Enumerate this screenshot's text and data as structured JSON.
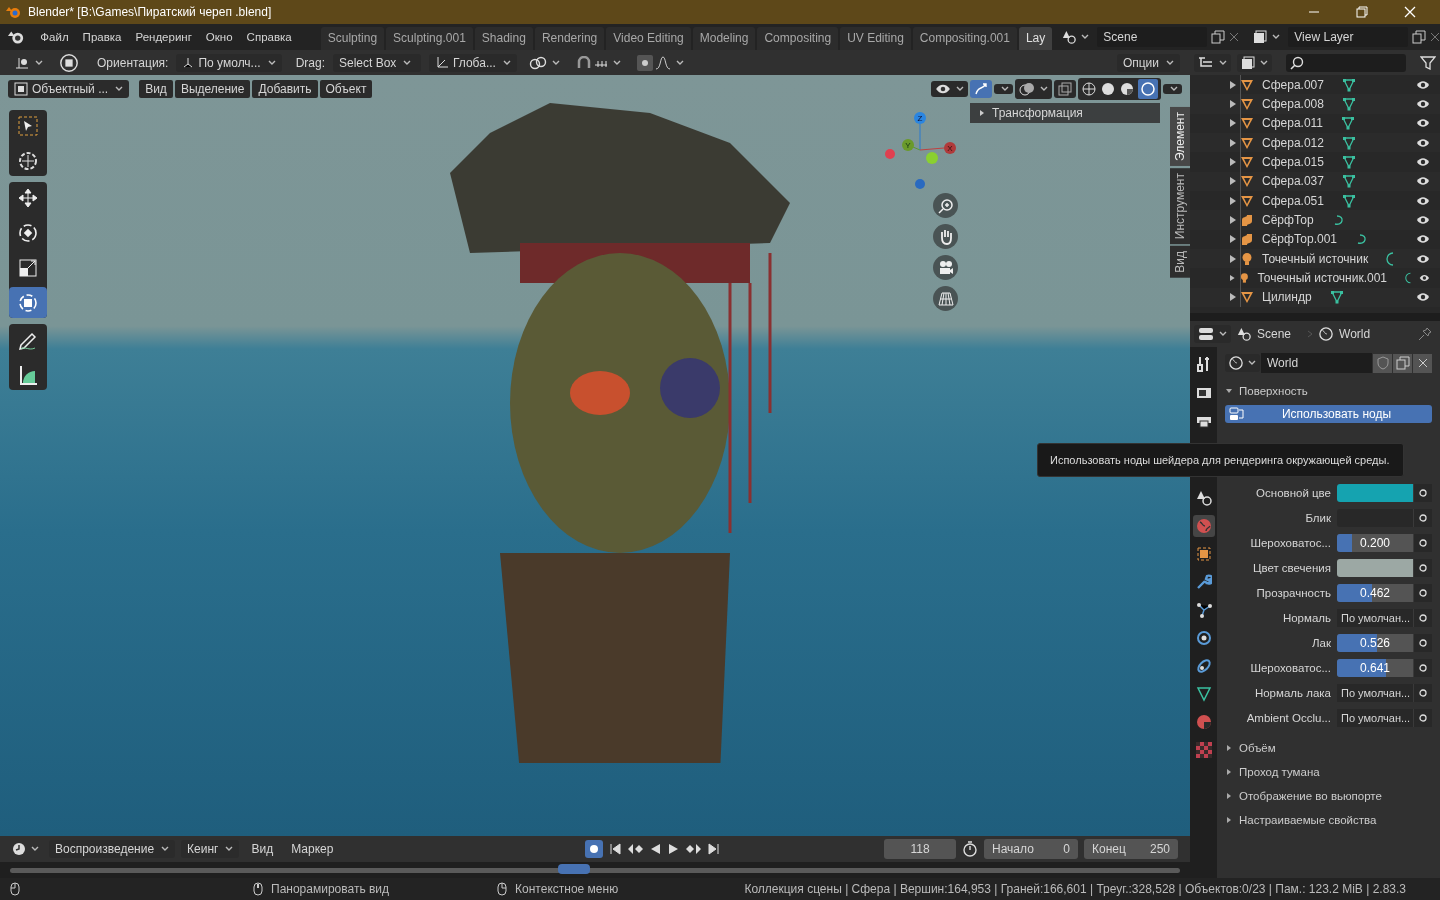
{
  "window": {
    "title": "Blender* [B:\\Games\\Пиратский череп .blend]"
  },
  "menu": [
    "Файл",
    "Правка",
    "Рендеринг",
    "Окно",
    "Справка"
  ],
  "workspace_tabs": [
    {
      "label": "Sculpting",
      "selected": false
    },
    {
      "label": "Sculpting.001",
      "selected": false
    },
    {
      "label": "Shading",
      "selected": false
    },
    {
      "label": "Rendering",
      "selected": false
    },
    {
      "label": "Video Editing",
      "selected": false
    },
    {
      "label": "Modeling",
      "selected": false
    },
    {
      "label": "Compositing",
      "selected": false
    },
    {
      "label": "UV Editing",
      "selected": false
    },
    {
      "label": "Compositing.001",
      "selected": false
    },
    {
      "label": "Lay",
      "selected": true
    }
  ],
  "scene": "Scene",
  "view_layer": "View Layer",
  "tool_header": {
    "orientation_label": "Ориентация:",
    "orientation": "По умолч...",
    "drag_label": "Drag:",
    "drag": "Select Box",
    "transform": "Глоба...",
    "options": "Опции"
  },
  "viewport_header": {
    "mode": "Объектный ...",
    "menus": [
      "Вид",
      "Выделение",
      "Добавить",
      "Объект"
    ]
  },
  "tool_groups": [
    [
      {
        "kind": "select",
        "selected": false
      },
      {
        "kind": "cursor",
        "selected": false
      }
    ],
    [
      {
        "kind": "move",
        "selected": false
      },
      {
        "kind": "rotate",
        "selected": false
      },
      {
        "kind": "scale",
        "selected": false
      },
      {
        "kind": "transform",
        "selected": true
      }
    ],
    [
      {
        "kind": "annotate",
        "selected": false
      },
      {
        "kind": "measure",
        "selected": false
      }
    ]
  ],
  "gizmo": {
    "x": "X",
    "y": "Y",
    "z": "Z"
  },
  "sidebar": {
    "panel": "Трансформация",
    "tabs": [
      {
        "label": "Элемент",
        "selected": true
      },
      {
        "label": "Инструмент",
        "selected": false
      },
      {
        "label": "Вид",
        "selected": false
      }
    ]
  },
  "outliner": {
    "items": [
      {
        "name": "Сфера.007",
        "kind": "mesh"
      },
      {
        "name": "Сфера.008",
        "kind": "mesh"
      },
      {
        "name": "Сфера.011",
        "kind": "mesh"
      },
      {
        "name": "Сфера.012",
        "kind": "mesh"
      },
      {
        "name": "Сфера.015",
        "kind": "mesh"
      },
      {
        "name": "Сфера.037",
        "kind": "mesh"
      },
      {
        "name": "Сфера.051",
        "kind": "mesh"
      },
      {
        "name": "СёрфТор",
        "kind": "surface"
      },
      {
        "name": "СёрфТор.001",
        "kind": "surface"
      },
      {
        "name": "Точечный источник",
        "kind": "light"
      },
      {
        "name": "Точечный источник.001",
        "kind": "light"
      },
      {
        "name": "Цилиндр",
        "kind": "mesh"
      }
    ]
  },
  "properties": {
    "breadcrumb": [
      "Scene",
      "World"
    ],
    "datablock": "World",
    "tabs": [
      {
        "kind": "tool",
        "selected": false
      },
      {
        "kind": "render",
        "selected": false
      },
      {
        "kind": "output",
        "selected": false
      },
      {
        "kind": "scene",
        "selected": false
      },
      {
        "kind": "world",
        "selected": true
      },
      {
        "kind": "object",
        "selected": false
      },
      {
        "kind": "modifiers",
        "selected": false
      },
      {
        "kind": "particles",
        "selected": false
      },
      {
        "kind": "physics",
        "selected": false
      },
      {
        "kind": "constraints",
        "selected": false
      },
      {
        "kind": "data",
        "selected": false
      },
      {
        "kind": "material",
        "selected": false
      },
      {
        "kind": "texture",
        "selected": false
      }
    ],
    "surface_panel": "Поверхность",
    "use_nodes": "Использовать ноды",
    "rows": [
      {
        "label": "Основной цве",
        "kind": "color",
        "color": "#15a3b0"
      },
      {
        "label": "Блик",
        "kind": "color",
        "color": "#282828"
      },
      {
        "label": "Шероховатос...",
        "kind": "slider",
        "value": "0.200",
        "level": 0.2
      },
      {
        "label": "Цвет свечения",
        "kind": "color",
        "color": "#9ca8a4"
      },
      {
        "label": "Прозрачность",
        "kind": "slider",
        "value": "0.462",
        "level": 0.462
      },
      {
        "label": "Нормаль",
        "kind": "dropdown",
        "value": "По умолчан..."
      },
      {
        "label": "Лак",
        "kind": "slider",
        "value": "0.526",
        "level": 0.526
      },
      {
        "label": "Шероховатос...",
        "kind": "slider",
        "value": "0.641",
        "level": 0.641
      },
      {
        "label": "Нормаль лака",
        "kind": "dropdown",
        "value": "По умолчан..."
      },
      {
        "label": "Ambient Occlu...",
        "kind": "dropdown",
        "value": "По умолчан..."
      }
    ],
    "collapsed_panels": [
      "Объём",
      "Проход тумана",
      "Отображение во вьюпорте",
      "Настраиваемые свойства"
    ]
  },
  "tooltip": "Использовать ноды шейдера для рендеринга окружающей среды.",
  "timeline": {
    "menus": [
      {
        "label": "Воспроизведение",
        "dropdown": true
      },
      {
        "label": "Кеинг",
        "dropdown": true
      },
      {
        "label": "Вид",
        "dropdown": false
      },
      {
        "label": "Маркер",
        "dropdown": false
      }
    ],
    "current_frame": "118",
    "start_label": "Начало",
    "start": "0",
    "end_label": "Конец",
    "end": "250"
  },
  "status_bar": {
    "hints": [
      "Панорамировать вид",
      "Контекстное меню"
    ],
    "stats": "Коллекция сцены | Сфера | Вершин:164,953 | Граней:166,601 | Треуг.:328,528 | Объектов:0/23 | Пам.: 123.2 MiB | 2.83.3"
  }
}
